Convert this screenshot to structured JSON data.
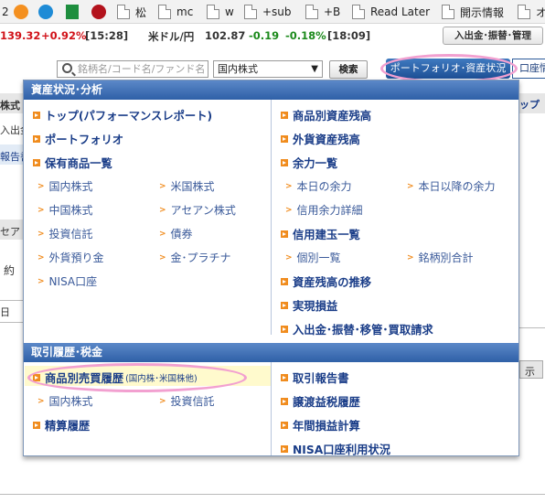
{
  "bookmarks": [
    {
      "label": "2",
      "icon": "number-icon"
    },
    {
      "label": "",
      "icon": "orange-swirl-icon"
    },
    {
      "label": "",
      "icon": "globe-icon"
    },
    {
      "label": "",
      "icon": "spreadsheet-icon"
    },
    {
      "label": "",
      "icon": "red-logo-icon"
    },
    {
      "label": "松",
      "icon": "document-icon"
    },
    {
      "label": "mc",
      "icon": "document-icon"
    },
    {
      "label": "w",
      "icon": "document-icon"
    },
    {
      "label": "+sub",
      "icon": "document-icon"
    },
    {
      "label": "+B",
      "icon": "document-icon"
    },
    {
      "label": "Read Later",
      "icon": "document-icon"
    },
    {
      "label": "開示情報",
      "icon": "document-icon"
    },
    {
      "label": "オ",
      "icon": "document-icon"
    }
  ],
  "ticker": {
    "index_value": "139.32",
    "index_change": "+0.92%",
    "index_time": "[15:28]",
    "fx_label": "米ドル/円",
    "fx_value": "102.87",
    "fx_change": "-0.19",
    "fx_change_pct": "-0.18%",
    "fx_time": "[18:09]",
    "deposit_button": "入出金･振替･管理"
  },
  "search": {
    "placeholder": "銘柄名/コード名/ファンド名",
    "market_select": "国内株式",
    "search_button": "検索"
  },
  "nav": {
    "portfolio_tab": "ポートフォリオ･資産状況",
    "account_tab": "口座情"
  },
  "background": {
    "frag1": "株式",
    "frag2": "入出金",
    "frag3": "報告書",
    "frag4": "セア",
    "frag5": "約",
    "frag6": "日",
    "frag7": "ップ",
    "frag8": "示"
  },
  "menu": {
    "section1_title": "資産状況･分析",
    "left": {
      "top_performance": "トップ(パフォーマンスレポート)",
      "portfolio": "ポートフォリオ",
      "holdings": "保有商品一覧",
      "domestic_stock": "国内株式",
      "us_stock": "米国株式",
      "china_stock": "中国株式",
      "asean_stock": "アセアン株式",
      "investment_trust": "投資信託",
      "bonds": "債券",
      "fx_deposit": "外貨預り金",
      "gold_platinum": "金･プラチナ",
      "nisa_account": "NISA口座"
    },
    "right": {
      "balance_by_product": "商品別資産残高",
      "fx_balance": "外貨資産残高",
      "available_funds": "余力一覧",
      "today_funds": "本日の余力",
      "after_today_funds": "本日以降の余力",
      "credit_funds_detail": "信用余力詳細",
      "margin_positions": "信用建玉一覧",
      "individual_list": "個別一覧",
      "by_issue_total": "銘柄別合計",
      "balance_trend": "資産残高の推移",
      "realized_pl": "実現損益",
      "deposit_transfer": "入出金･振替･移管･買取請求"
    },
    "section2_title": "取引履歴･税金",
    "left2": {
      "trade_history": "商品別売買履歴",
      "trade_history_note": "(国内株･米国株他)",
      "domestic_stock": "国内株式",
      "investment_trust": "投資信託",
      "settlement_history": "精算履歴"
    },
    "right2": {
      "trade_report": "取引報告書",
      "capital_gains_tax": "譲渡益税履歴",
      "annual_pl": "年間損益計算",
      "nisa_usage": "NISA口座利用状況"
    }
  },
  "colors": {
    "menu_header": "#2f60a7",
    "link": "#1a3d88",
    "bullet": "#f08c1e",
    "highlight": "#fffacd",
    "annotation": "#f2a0d0",
    "positive": "#d1131a",
    "negative": "#1c8a1c"
  }
}
